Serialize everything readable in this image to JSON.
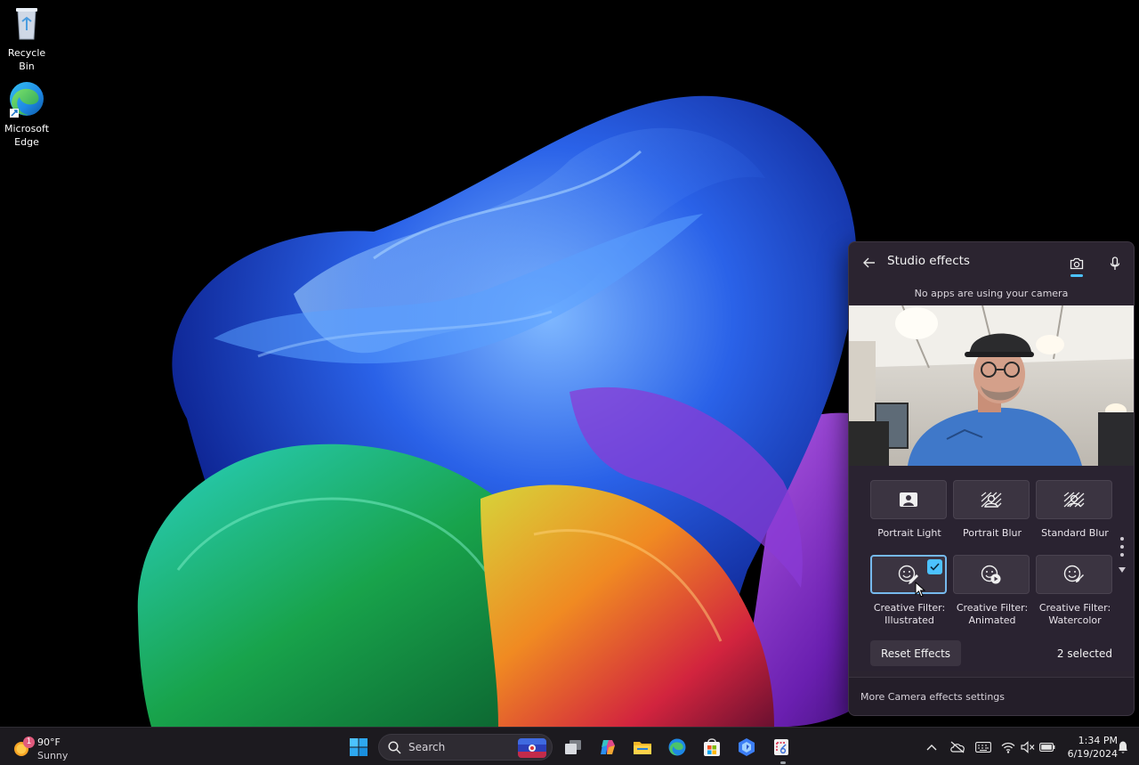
{
  "desktop": {
    "icons": [
      {
        "label": "Recycle Bin",
        "icon": "recycle-bin-icon"
      },
      {
        "label": "Microsoft Edge",
        "icon": "edge-icon"
      }
    ]
  },
  "studio_effects": {
    "title": "Studio effects",
    "back_icon": "back-arrow-icon",
    "tabs": [
      {
        "icon": "camera-icon",
        "active": true
      },
      {
        "icon": "microphone-icon",
        "active": false
      }
    ],
    "status": "No apps are using your camera",
    "effects": [
      {
        "label": "Portrait Light",
        "icon": "portrait-light-icon",
        "selected": false
      },
      {
        "label": "Portrait Blur",
        "icon": "portrait-blur-icon",
        "selected": false
      },
      {
        "label": "Standard Blur",
        "icon": "standard-blur-icon",
        "selected": false
      },
      {
        "label": "Creative Filter: Illustrated",
        "line1": "Creative Filter:",
        "line2": "Illustrated",
        "icon": "illustrated-filter-icon",
        "selected": true
      },
      {
        "label": "Creative Filter: Animated",
        "line1": "Creative Filter:",
        "line2": "Animated",
        "icon": "animated-filter-icon",
        "selected": false
      },
      {
        "label": "Creative Filter: Watercolor",
        "line1": "Creative Filter:",
        "line2": "Watercolor",
        "icon": "watercolor-filter-icon",
        "selected": false
      }
    ],
    "reset_label": "Reset Effects",
    "selected_count": "2 selected",
    "footer_link": "More Camera effects settings",
    "accent": "#4cc2ff"
  },
  "taskbar": {
    "weather": {
      "badge": "1",
      "temp": "90°F",
      "condition": "Sunny"
    },
    "search_placeholder": "Search",
    "apps": [
      "start-icon",
      "task-view-icon",
      "copilot-icon",
      "file-explorer-icon",
      "edge-icon",
      "store-icon",
      "bing-icon",
      "snipping-tool-icon"
    ],
    "tray": [
      "chevron-up-icon",
      "onedrive-icon",
      "keyboard-icon",
      "wifi-icon",
      "volume-muted-icon",
      "battery-icon"
    ],
    "time": "1:34 PM",
    "date": "6/19/2024",
    "notification_icon": "bell-icon"
  }
}
